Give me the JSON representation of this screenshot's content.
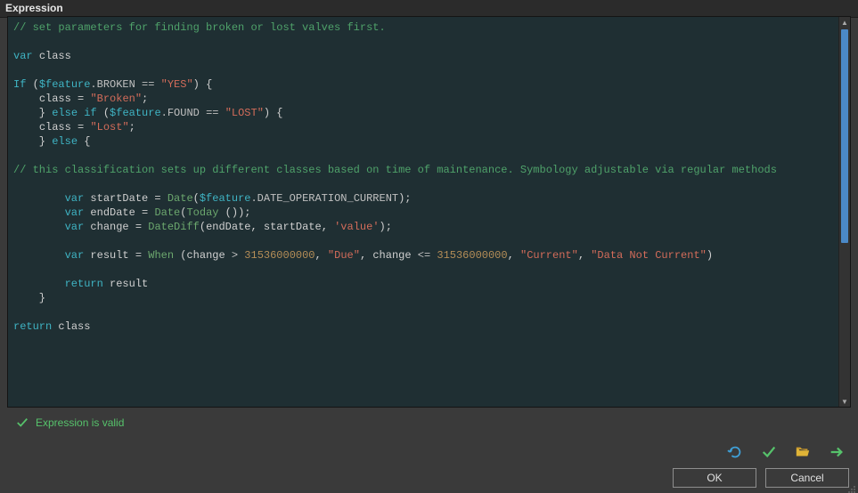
{
  "window": {
    "title": "Expression"
  },
  "code": {
    "line1_comment": "// set parameters for finding broken or lost valves first.",
    "var_kw": "var",
    "class_ident": "class",
    "if_kw": "If",
    "feature_global": "$feature",
    "broken_prop": ".BROKEN",
    "eq_op": "==",
    "yes_str": "\"YES\"",
    "broken_str": "\"Broken\"",
    "else_kw": "else",
    "if2_kw": "if",
    "found_prop": ".FOUND",
    "lost_cond_str": "\"LOST\"",
    "lost_str": "\"Lost\"",
    "comment2": "// this classification sets up different classes based on time of maintenance. Symbology adjustable via regular methods",
    "startDate_ident": "startDate",
    "date_func": "Date",
    "date_op_prop": ".DATE_OPERATION_CURRENT",
    "endDate_ident": "endDate",
    "today_func": "Today",
    "change_ident": "change",
    "datediff_func": "DateDiff",
    "value_str": "'value'",
    "result_ident": "result",
    "when_func": "When",
    "gt_op": ">",
    "lte_op": "<=",
    "big_number": "31536000000",
    "due_str": "\"Due\"",
    "current_str": "\"Current\"",
    "notcurrent_str": "\"Data Not Current\"",
    "return_kw": "return"
  },
  "status": {
    "message": "Expression is valid"
  },
  "buttons": {
    "ok": "OK",
    "cancel": "Cancel"
  },
  "toolbar_icons": {
    "revert": "revert-icon",
    "validate": "validate-icon",
    "open": "open-icon",
    "export": "export-icon"
  }
}
